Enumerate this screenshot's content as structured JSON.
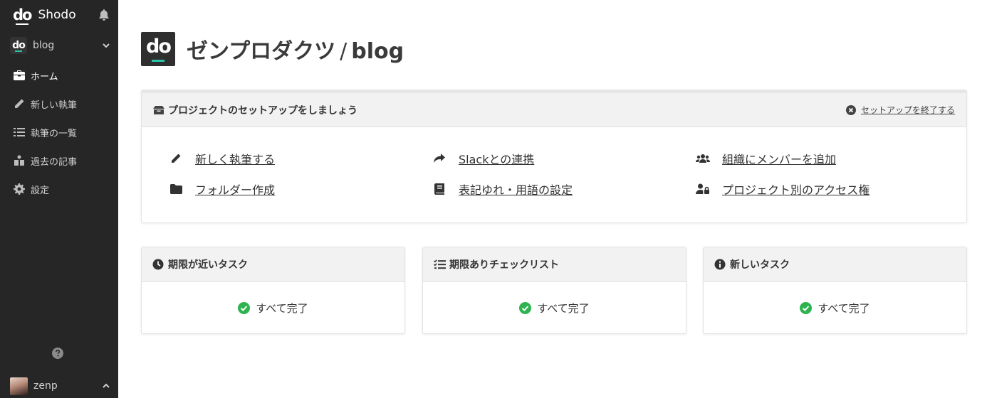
{
  "sidebar": {
    "brand_name": "Shodo",
    "brand_logo": "do",
    "project": {
      "logo": "do",
      "name": "blog"
    },
    "nav": [
      {
        "label": "ホーム",
        "icon": "briefcase-icon",
        "active": true
      },
      {
        "label": "新しい執筆",
        "icon": "pencil-icon",
        "active": false
      },
      {
        "label": "執筆の一覧",
        "icon": "list-icon",
        "active": false
      },
      {
        "label": "過去の記事",
        "icon": "archive-icon",
        "active": false
      },
      {
        "label": "設定",
        "icon": "gear-icon",
        "active": false
      }
    ],
    "user": {
      "name": "zenp"
    }
  },
  "header": {
    "logo": "do",
    "org": "ゼンプロダクツ",
    "separator": "/",
    "project": "blog"
  },
  "setup": {
    "title": "プロジェクトのセットアップをしましょう",
    "close_label": "セットアップを終了する",
    "links": [
      {
        "label": "新しく執筆する",
        "icon": "pencil-icon"
      },
      {
        "label": "Slackとの連携",
        "icon": "share-icon"
      },
      {
        "label": "組織にメンバーを追加",
        "icon": "users-icon"
      },
      {
        "label": "フォルダー作成",
        "icon": "folder-icon"
      },
      {
        "label": "表記ゆれ・用語の設定",
        "icon": "book-icon"
      },
      {
        "label": "プロジェクト別のアクセス権",
        "icon": "user-lock-icon"
      }
    ]
  },
  "cards": [
    {
      "title": "期限が近いタスク",
      "icon": "clock-icon",
      "status": "すべて完了"
    },
    {
      "title": "期限ありチェックリスト",
      "icon": "checklist-icon",
      "status": "すべて完了"
    },
    {
      "title": "新しいタスク",
      "icon": "info-icon",
      "status": "すべて完了"
    }
  ],
  "colors": {
    "sidebar_bg": "#262626",
    "accent": "#27c4a8",
    "success": "#2eb34f"
  }
}
